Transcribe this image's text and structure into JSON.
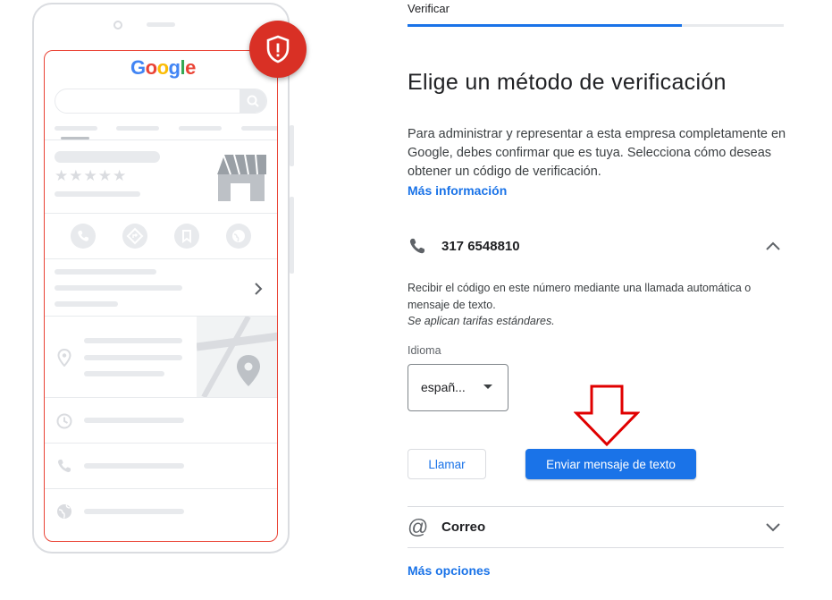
{
  "phone_illustration": {
    "logo_letters": [
      {
        "ch": "G",
        "color": "#4285f4"
      },
      {
        "ch": "o",
        "color": "#ea4335"
      },
      {
        "ch": "o",
        "color": "#fbbc05"
      },
      {
        "ch": "g",
        "color": "#4285f4"
      },
      {
        "ch": "l",
        "color": "#34a853"
      },
      {
        "ch": "e",
        "color": "#ea4335"
      }
    ],
    "stars": "★★★★★"
  },
  "colors": {
    "accent": "#1a73e8",
    "badge": "#d93025",
    "arrow": "#e00000",
    "placeholder": "#e8eaed"
  },
  "header": {
    "step_label": "Verificar",
    "progress": 0.73
  },
  "main": {
    "title": "Elige un método de verificación",
    "description": "Para administrar y representar a esta empresa completamente en Google, debes confirmar que es tuya. Selecciona cómo deseas obtener un código de verificación.",
    "more_info_link": "Más información"
  },
  "phone_option": {
    "icon": "phone-icon",
    "number": "317 6548810",
    "expanded": true,
    "description": "Recibir el código en este número mediante una llamada automática o mensaje de texto.",
    "note": "Se aplican tarifas estándares.",
    "language_label": "Idioma",
    "language_value": "españ...",
    "call_button": "Llamar",
    "text_button": "Enviar mensaje de texto"
  },
  "mail_option": {
    "icon": "at-sign-icon",
    "label": "Correo"
  },
  "more_options_link": "Más opciones"
}
